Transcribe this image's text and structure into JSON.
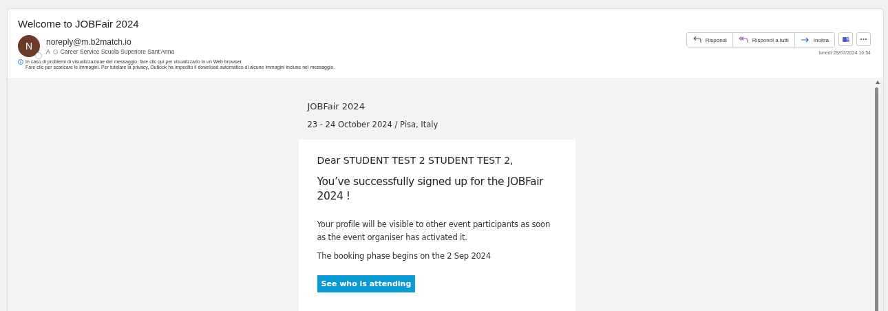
{
  "subject": "Welcome to JOBFair 2024",
  "sender": {
    "initial": "N",
    "address": "noreply@m.b2match.io",
    "to_label": "A",
    "recipient": "Career Service Scuola Superiore Sant'Anna"
  },
  "notice": [
    "In caso di problemi di visualizzazione del messaggio, fare clic qui per visualizzarlo in un Web browser.",
    "Fare clic per scaricare le immagini. Per tutelare la privacy, Outlook ha impedito il download automatico di alcune immagini incluse nel messaggio."
  ],
  "actions": [
    {
      "kind": "reply",
      "label": "Rispondi"
    },
    {
      "kind": "reply_all",
      "label": "Rispondi a tutti"
    },
    {
      "kind": "forward",
      "label": "Inoltra"
    }
  ],
  "timestamp": "lunedì 29/07/2024 16:54",
  "body": {
    "event_title": "JOBFair 2024",
    "event_date": "23 - 24 October 2024 / Pisa, Italy",
    "greeting": "Dear STUDENT TEST 2 STUDENT TEST 2,",
    "headline": "You’ve successfully signed up for the JOBFair 2024 !",
    "paragraphs": [
      "Your profile will be visible to other event participants as soon as the event organiser has activated it.",
      "The booking phase begins on the 2 Sep 2024"
    ],
    "cta": "See who is attending"
  }
}
